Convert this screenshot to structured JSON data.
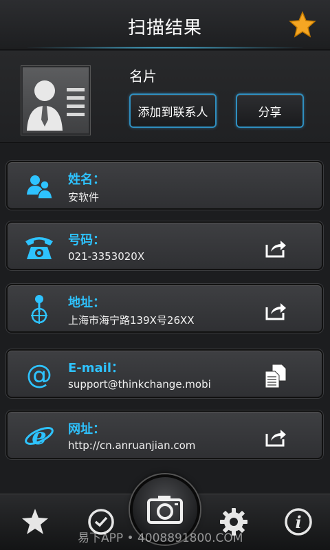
{
  "header": {
    "title": "扫描结果"
  },
  "card": {
    "label": "名片",
    "add_contact_label": "添加到联系人",
    "share_label": "分享"
  },
  "rows": [
    {
      "label": "姓名：",
      "value": "安软件",
      "icon": "contacts-icon"
    },
    {
      "label": "号码：",
      "value": "021-3353020X",
      "icon": "telephone-icon",
      "action": "share-icon"
    },
    {
      "label": "地址：",
      "value": "上海市海宁路139X号26XX",
      "icon": "location-pin-icon",
      "action": "share-icon"
    },
    {
      "label": "E-mail：",
      "value": "support@thinkchange.mobi",
      "icon": "at-sign-icon",
      "action": "copy-icon"
    },
    {
      "label": "网址：",
      "value": "http://cn.anruanjian.com",
      "icon": "internet-explorer-icon",
      "action": "share-icon"
    }
  ],
  "bottom_bar": {
    "tabs": [
      "favorites-star-icon",
      "history-clock-icon",
      "camera-icon",
      "settings-gear-icon",
      "info-icon"
    ]
  },
  "watermark": "易下APP • 4008891800.COM",
  "colors": {
    "accent": "#2ec3ff",
    "star": "#f5a623",
    "button_border": "#2f8fc0"
  }
}
